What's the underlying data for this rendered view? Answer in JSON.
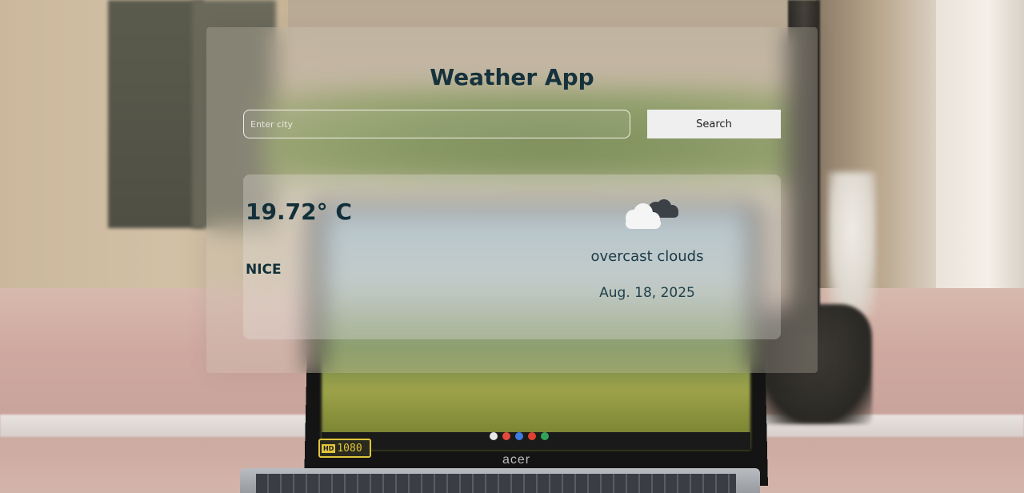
{
  "app": {
    "title": "Weather App"
  },
  "search": {
    "placeholder": "Enter city",
    "value": "",
    "button_label": "Search"
  },
  "weather": {
    "temperature": "19.72° C",
    "city": "NICE",
    "condition": "overcast clouds",
    "date": "Aug. 18, 2025",
    "icon": "overcast-clouds-icon"
  },
  "background": {
    "laptop_brand": "acer",
    "hd_badge": "HD",
    "resolution_badge": "1080"
  },
  "colors": {
    "title": "#16323c",
    "text": "#123039",
    "button_bg": "#efefef"
  }
}
